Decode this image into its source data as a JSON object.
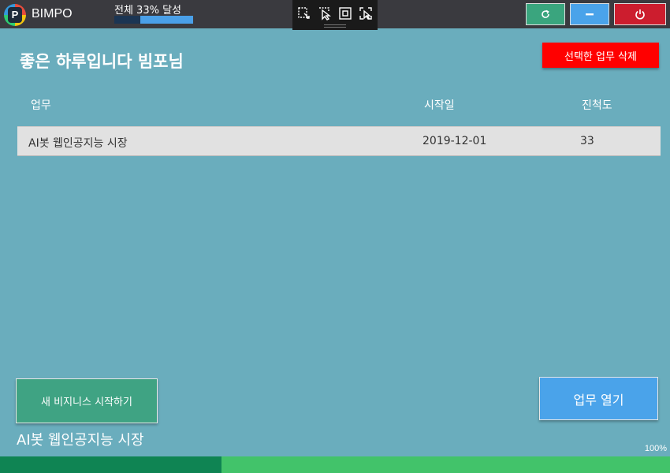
{
  "app": {
    "name": "BIMPO",
    "overall_label": "전체 33% 달성",
    "overall_progress": 0.33
  },
  "toolbox": {
    "icons": [
      "select-area-icon",
      "pointer-select-icon",
      "frame-icon",
      "capture-icon"
    ]
  },
  "window_controls": {
    "refresh_icon": "refresh-icon",
    "minimize_icon": "minimize-icon",
    "power_icon": "power-icon",
    "colors": {
      "refresh": "#3aa57e",
      "minimize": "#4aa3ea",
      "power": "#cc1d2e"
    }
  },
  "main": {
    "greeting": "좋은 하루입니다 빔포님",
    "delete_button": "선택한 업무 삭제",
    "table": {
      "headers": {
        "task": "업무",
        "start_date": "시작일",
        "progress": "진척도"
      },
      "rows": [
        {
          "task": "AI봇 웹인공지능 시장",
          "start_date": "2019-12-01",
          "progress": "33"
        }
      ]
    },
    "new_business_button": "새 비지니스 시작하기",
    "open_task_button": "업무 열기",
    "current_task": "AI봇 웹인공지능 시장",
    "zoom": "100%",
    "task_progress": 0.33
  },
  "colors": {
    "background": "#6aadbd",
    "titlebar": "#3a3a3f",
    "delete": "#ff0000",
    "new_business": "#3fa383",
    "open_task": "#4aa3ea",
    "bottom_fill": "#0f8453",
    "bottom_track": "#42c36a"
  }
}
